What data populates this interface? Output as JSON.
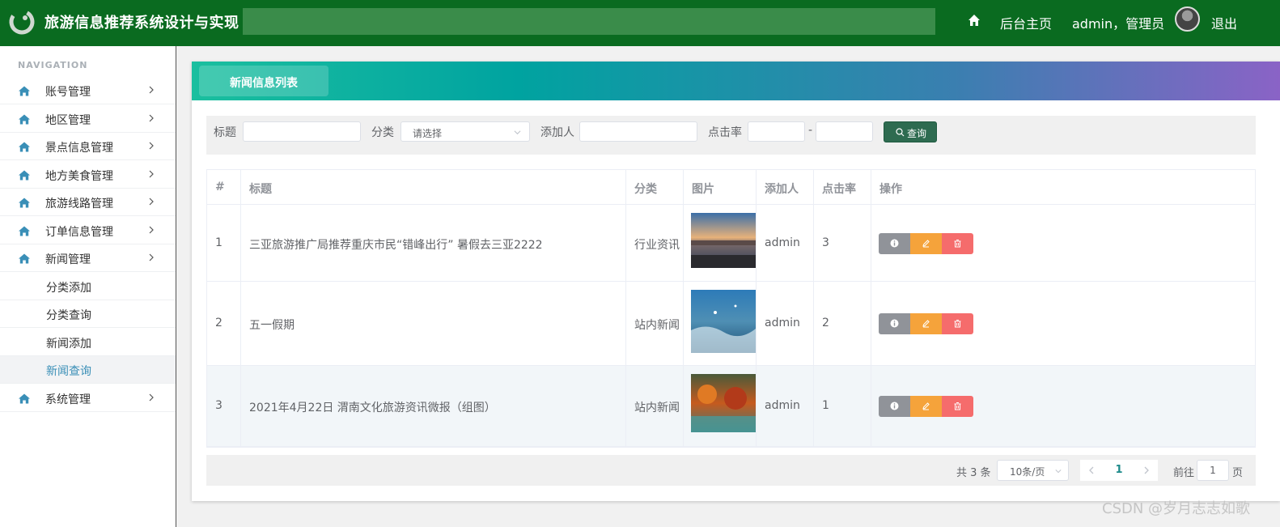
{
  "header": {
    "app_title": "旅游信息推荐系统设计与实现",
    "home_link": "后台主页",
    "user_text": "admin，管理员",
    "logout": "退出",
    "bg_color": "#0a6b20"
  },
  "sidebar": {
    "caption": "NAVIGATION",
    "items": [
      {
        "label": "账号管理",
        "icon": "home-icon"
      },
      {
        "label": "地区管理",
        "icon": "home-icon"
      },
      {
        "label": "景点信息管理",
        "icon": "home-icon"
      },
      {
        "label": "地方美食管理",
        "icon": "home-icon"
      },
      {
        "label": "旅游线路管理",
        "icon": "home-icon"
      },
      {
        "label": "订单信息管理",
        "icon": "home-icon"
      },
      {
        "label": "新闻管理",
        "icon": "home-icon"
      }
    ],
    "sub_items": [
      {
        "label": "分类添加"
      },
      {
        "label": "分类查询"
      },
      {
        "label": "新闻添加"
      },
      {
        "label": "新闻查询",
        "active": true
      }
    ],
    "last_item": {
      "label": "系统管理",
      "icon": "home-icon"
    }
  },
  "panel": {
    "tab_title": "新闻信息列表"
  },
  "search": {
    "title_label": "标题",
    "title_value": "",
    "category_label": "分类",
    "category_placeholder": "请选择",
    "adder_label": "添加人",
    "adder_value": "",
    "clicks_label": "点击率",
    "clicks_from": "",
    "clicks_to": "",
    "range_sep": "-",
    "query_button": "查询"
  },
  "table": {
    "columns": [
      "#",
      "标题",
      "分类",
      "图片",
      "添加人",
      "点击率",
      "操作"
    ],
    "rows": [
      {
        "index": "1",
        "title": "三亚旅游推广局推荐重庆市民“错峰出行” 暑假去三亚2222",
        "category": "行业资讯",
        "image": "lake-sunset-photo",
        "adder": "admin",
        "clicks": "3"
      },
      {
        "index": "2",
        "title": "五一假期",
        "category": "站内新闻",
        "image": "sea-waves-photo",
        "adder": "admin",
        "clicks": "2"
      },
      {
        "index": "3",
        "title": "2021年4月22日 渭南文化旅游资讯微报（组图）",
        "category": "站内新闻",
        "image": "autumn-lake-photo",
        "adder": "admin",
        "clicks": "1"
      }
    ]
  },
  "pagination": {
    "total": "共 3 条",
    "page_size": "10条/页",
    "current_page": "1",
    "goto_label": "前往",
    "goto_value": "1",
    "page_suffix": "页"
  },
  "watermark": "CSDN @岁月志志如歌"
}
